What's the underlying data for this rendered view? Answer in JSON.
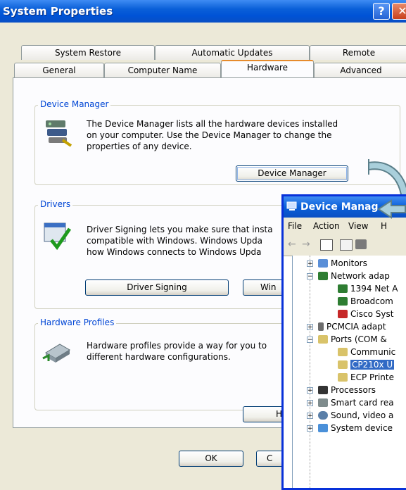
{
  "system_properties": {
    "title": "System Properties",
    "help_glyph": "?",
    "close_glyph": "✕",
    "tabs_row1": [
      "System Restore",
      "Automatic Updates",
      "Remote"
    ],
    "tabs_row2": [
      "General",
      "Computer Name",
      "Hardware",
      "Advanced"
    ],
    "active_tab": "Hardware",
    "device_manager": {
      "label": "Device Manager",
      "line1": "The Device Manager lists all the hardware devices installed",
      "line2": "on your computer. Use the Device Manager to change the",
      "line3": "properties of any device.",
      "button": "Device Manager"
    },
    "drivers": {
      "label": "Drivers",
      "line1": "Driver Signing lets you make sure that insta",
      "line2": "compatible with Windows. Windows Upda",
      "line3": "how Windows connects to Windows Upda",
      "button_signing": "Driver Signing",
      "button_update": "Win"
    },
    "hardware_profiles": {
      "label": "Hardware Profiles",
      "line1": "Hardware profiles provide a way for you to",
      "line2": "different hardware configurations.",
      "button": "Har"
    },
    "ok_button": "OK",
    "cancel_button": "C"
  },
  "device_manager_window": {
    "title": "Device Manag",
    "menu": [
      "File",
      "Action",
      "View",
      "H"
    ],
    "tree": [
      {
        "label": "Monitors",
        "indent": 0,
        "expander": "+"
      },
      {
        "label": "Network adap",
        "indent": 0,
        "expander": "−"
      },
      {
        "label": "1394 Net A",
        "indent": 1
      },
      {
        "label": "Broadcom",
        "indent": 1
      },
      {
        "label": "Cisco Syst",
        "indent": 1
      },
      {
        "label": "PCMCIA adapt",
        "indent": 0,
        "expander": "+"
      },
      {
        "label": "Ports (COM &",
        "indent": 0,
        "expander": "−"
      },
      {
        "label": "Communic",
        "indent": 1
      },
      {
        "label": "CP210x U",
        "indent": 1,
        "selected": true
      },
      {
        "label": "ECP Printe",
        "indent": 1
      },
      {
        "label": "Processors",
        "indent": 0,
        "expander": "+"
      },
      {
        "label": "Smart card rea",
        "indent": 0,
        "expander": "+"
      },
      {
        "label": "Sound, video a",
        "indent": 0,
        "expander": "+"
      },
      {
        "label": "System device",
        "indent": 0,
        "expander": "+"
      }
    ]
  },
  "colors": {
    "accent_blue": "#0046d5",
    "title_blue": "#0a5fd8",
    "arrow_teal": "#6aa7b8",
    "selection": "#316ac5"
  }
}
